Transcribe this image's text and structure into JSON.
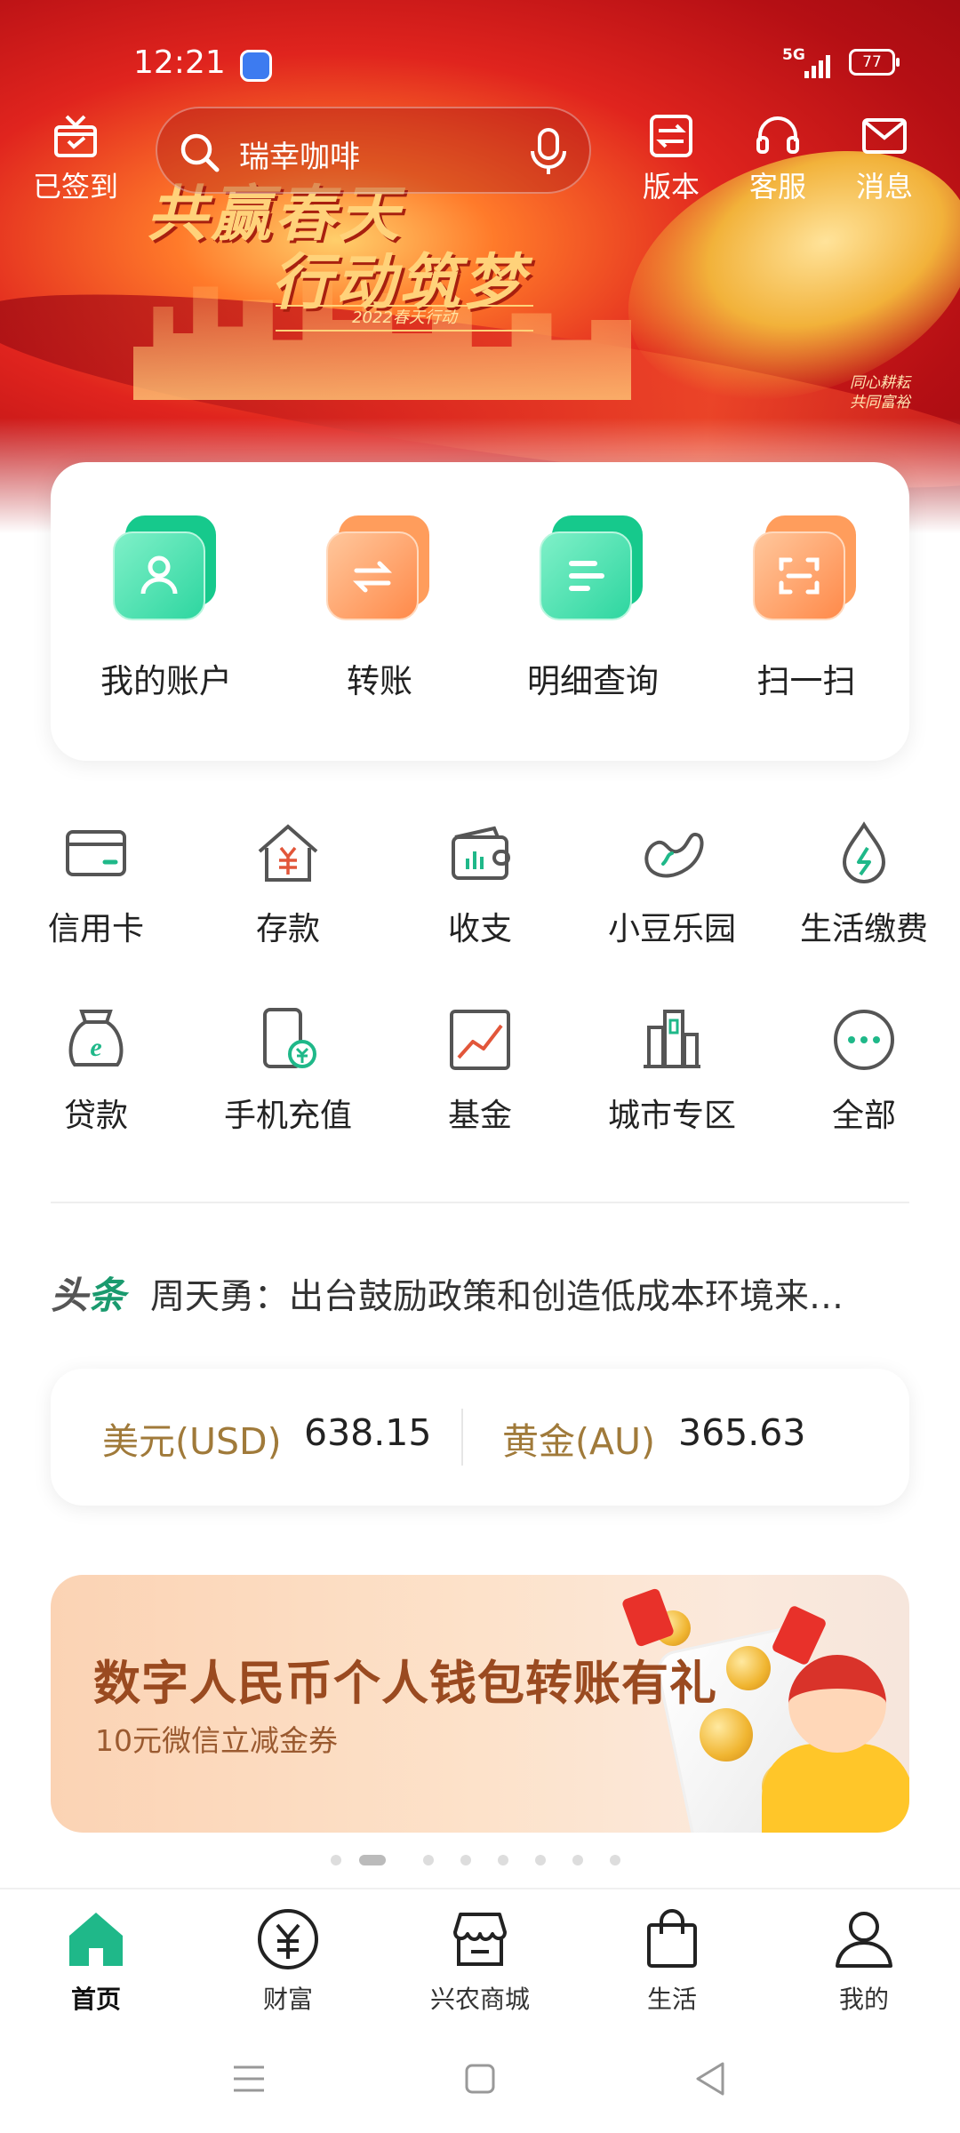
{
  "status_bar": {
    "time": "12:21",
    "network": "5G",
    "battery": "77"
  },
  "header": {
    "checkin_label": "已签到",
    "search_placeholder": "瑞幸咖啡",
    "actions": [
      {
        "label": "版本",
        "icon": "version-switch-icon"
      },
      {
        "label": "客服",
        "icon": "headset-icon"
      },
      {
        "label": "消息",
        "icon": "mail-icon"
      }
    ]
  },
  "banner": {
    "slogan_line1": "共赢春天",
    "slogan_line2": "行动筑梦",
    "subtitle": "2022春天行动",
    "sign": "同心耕耘 共同富裕"
  },
  "quick_actions": [
    {
      "label": "我的账户",
      "icon": "account-icon",
      "color": "green"
    },
    {
      "label": "转账",
      "icon": "transfer-icon",
      "color": "orange"
    },
    {
      "label": "明细查询",
      "icon": "details-icon",
      "color": "green"
    },
    {
      "label": "扫一扫",
      "icon": "scan-icon",
      "color": "orange"
    }
  ],
  "services": [
    {
      "label": "信用卡",
      "icon": "credit-card-icon"
    },
    {
      "label": "存款",
      "icon": "deposit-icon"
    },
    {
      "label": "收支",
      "icon": "wallet-icon"
    },
    {
      "label": "小豆乐园",
      "icon": "bean-icon"
    },
    {
      "label": "生活缴费",
      "icon": "bill-drop-icon"
    },
    {
      "label": "贷款",
      "icon": "loan-bag-icon"
    },
    {
      "label": "手机充值",
      "icon": "phone-recharge-icon"
    },
    {
      "label": "基金",
      "icon": "fund-chart-icon"
    },
    {
      "label": "城市专区",
      "icon": "city-building-icon"
    },
    {
      "label": "全部",
      "icon": "more-icon"
    }
  ],
  "news": {
    "tag_part1": "头",
    "tag_part2": "条",
    "headline": "周天勇：出台鼓励政策和创造低成本环境来…"
  },
  "rates": {
    "usd_label": "美元(USD)",
    "usd_value": "638.15",
    "gold_label": "黄金(AU)",
    "gold_value": "365.63"
  },
  "promo": {
    "title": "数字人民币个人钱包转账有礼",
    "subtitle": "10元微信立减金券",
    "page_count": 8,
    "active_page": 2
  },
  "tabbar": [
    {
      "label": "首页",
      "icon": "home-icon",
      "active": true
    },
    {
      "label": "财富",
      "icon": "yuan-coin-icon",
      "active": false
    },
    {
      "label": "兴农商城",
      "icon": "store-icon",
      "active": false
    },
    {
      "label": "生活",
      "icon": "shopping-bag-icon",
      "active": false
    },
    {
      "label": "我的",
      "icon": "user-icon",
      "active": false
    }
  ],
  "colors": {
    "accent_green": "#1fb889",
    "accent_orange": "#ff8a4a",
    "gold_text": "#a07a3a",
    "banner_red": "#d8261f"
  }
}
